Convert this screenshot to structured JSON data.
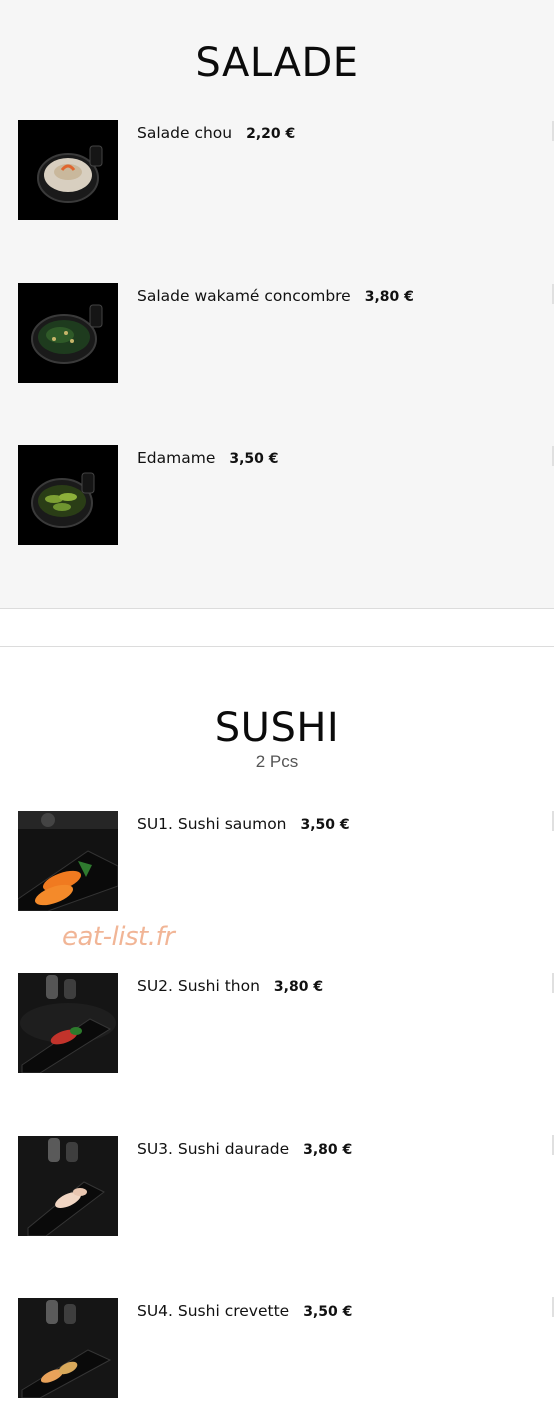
{
  "salade": {
    "title": "SALADE",
    "items": [
      {
        "name": "Salade chou",
        "price": "2,20 €"
      },
      {
        "name": "Salade wakamé concombre",
        "price": "3,80 €"
      },
      {
        "name": "Edamame",
        "price": "3,50 €"
      }
    ]
  },
  "sushi": {
    "title": "SUSHI",
    "subtitle": "2 Pcs",
    "items": [
      {
        "name": "SU1. Sushi saumon",
        "price": "3,50 €"
      },
      {
        "name": "SU2. Sushi thon",
        "price": "3,80 €"
      },
      {
        "name": "SU3. Sushi daurade",
        "price": "3,80 €"
      },
      {
        "name": "SU4. Sushi crevette",
        "price": "3,50 €"
      }
    ]
  },
  "watermark": {
    "text": "eat-list.fr",
    "color": "#f1b596"
  }
}
